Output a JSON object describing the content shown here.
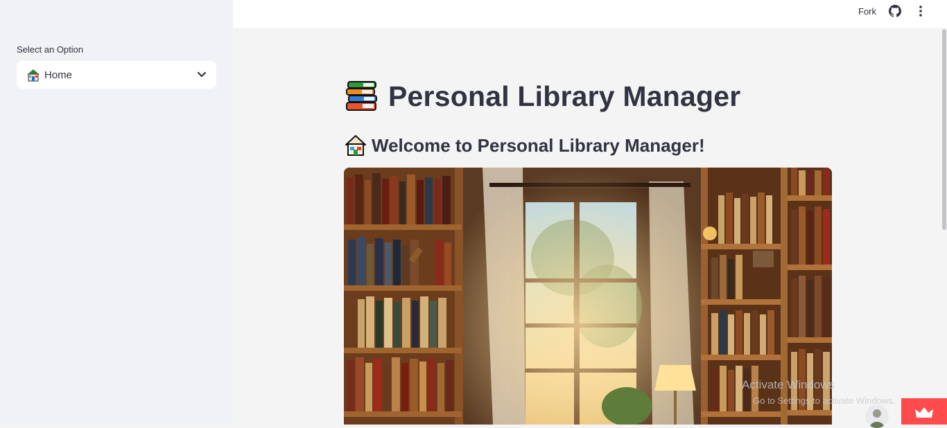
{
  "sidebar": {
    "select_label": "Select an Option",
    "select_value": "Home",
    "select_icon": "house-icon"
  },
  "header": {
    "fork_label": "Fork",
    "github_icon": "github-icon",
    "menu_icon": "more-vertical-icon"
  },
  "main": {
    "title": "Personal Library Manager",
    "title_icon": "books-icon",
    "subheading": "Welcome to Personal Library Manager!",
    "subheading_icon": "house-icon"
  },
  "watermark": {
    "line1": "Activate Windows",
    "line2": "Go to Settings to activate Windows."
  },
  "colors": {
    "accent": "#ff4b4b",
    "sidebar_bg": "#f0f2f6",
    "text": "#31333f"
  }
}
